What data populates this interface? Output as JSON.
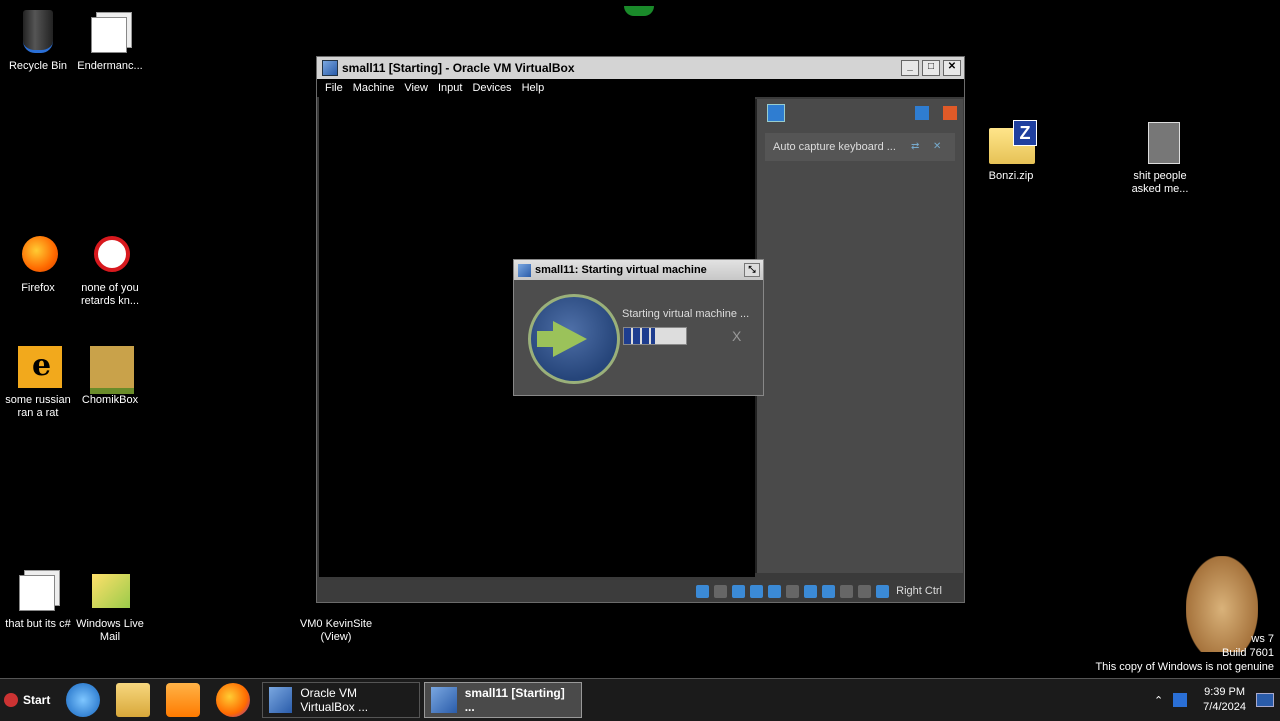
{
  "desktop": {
    "icons": [
      {
        "label": "Recycle Bin"
      },
      {
        "label": "Endermanc..."
      },
      {
        "label": "Firefox"
      },
      {
        "label": "none of you retards kn..."
      },
      {
        "label": "some russian ran a rat"
      },
      {
        "label": "ChomikBox"
      },
      {
        "label": "that but its c#"
      },
      {
        "label": "Windows Live Mail"
      },
      {
        "label": "VM0 KevinSite (View)"
      },
      {
        "label": "Bonzi.zip"
      },
      {
        "label": "shit people asked me..."
      }
    ]
  },
  "vbox_window": {
    "title": "small11 [Starting] - Oracle VM VirtualBox",
    "menu": [
      "File",
      "Machine",
      "View",
      "Input",
      "Devices",
      "Help"
    ],
    "notification": "Auto capture keyboard ...",
    "host_key": "Right Ctrl"
  },
  "progress_dialog": {
    "title": "small11: Starting virtual machine",
    "message": "Starting virtual machine ...",
    "progress": 0.5,
    "cancel_glyph": "X"
  },
  "taskbar": {
    "start_label": "Start",
    "tasks": [
      {
        "label": "Oracle VM VirtualBox ..."
      },
      {
        "label": "small11 [Starting] ..."
      }
    ],
    "time": "9:39 PM",
    "date": "7/4/2024"
  },
  "watermark": {
    "line1": "ws 7",
    "line2": "Build 7601",
    "line3": "This copy of Windows is not genuine"
  }
}
